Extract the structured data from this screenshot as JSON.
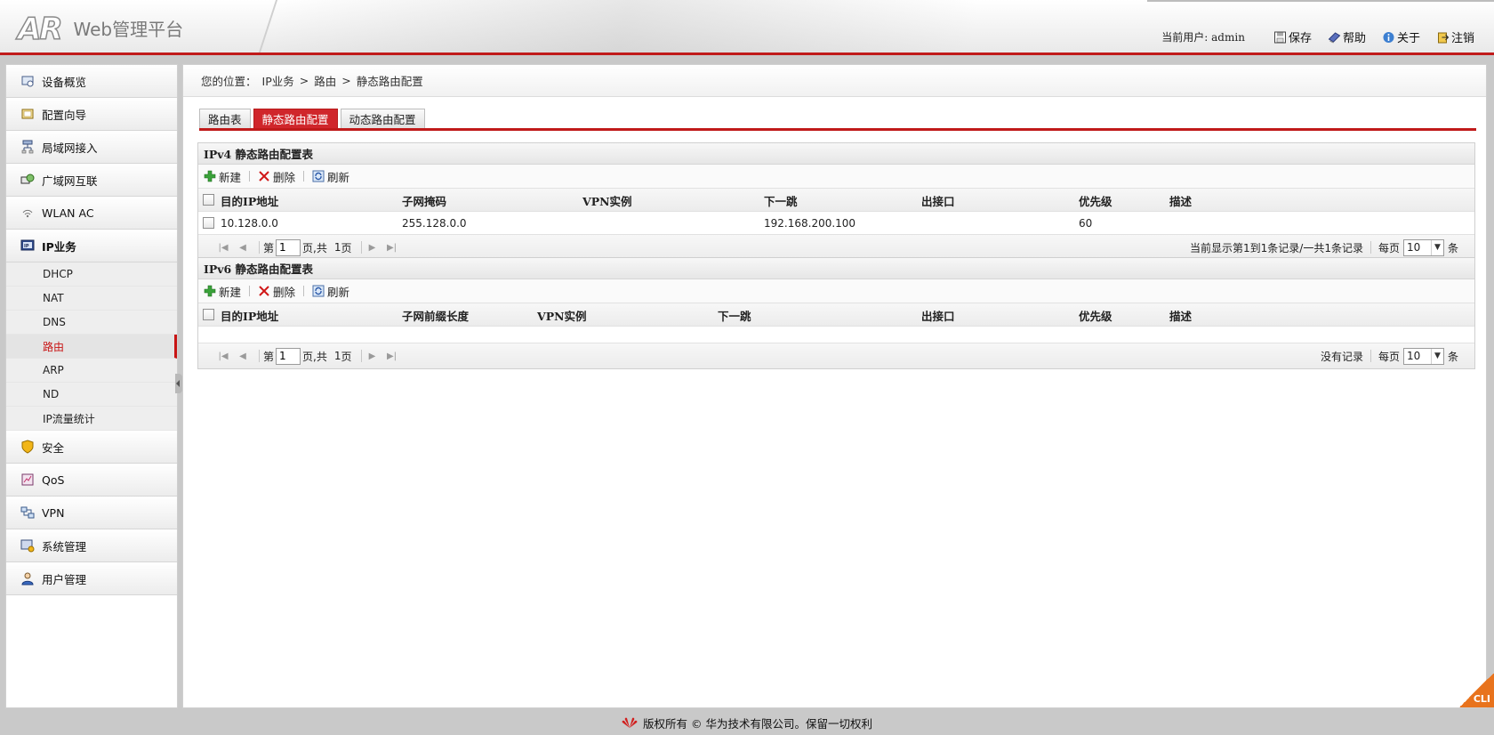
{
  "header": {
    "logo_mark": "AR",
    "title": "Web管理平台",
    "user_label": "当前用户: admin",
    "links": {
      "save": "保存",
      "help": "帮助",
      "about": "关于",
      "logout": "注销"
    }
  },
  "sidebar": {
    "items": [
      {
        "label": "设备概览",
        "icon": "overview-icon"
      },
      {
        "label": "配置向导",
        "icon": "wizard-icon"
      },
      {
        "label": "局域网接入",
        "icon": "lan-icon"
      },
      {
        "label": "广域网互联",
        "icon": "wan-icon"
      },
      {
        "label": "WLAN AC",
        "icon": "wlan-icon"
      },
      {
        "label": "IP业务",
        "icon": "ip-service-icon"
      }
    ],
    "sub_items": [
      "DHCP",
      "NAT",
      "DNS",
      "路由",
      "ARP",
      "ND",
      "IP流量统计"
    ],
    "items_after": [
      {
        "label": "安全",
        "icon": "security-shield-icon"
      },
      {
        "label": "QoS",
        "icon": "qos-icon"
      },
      {
        "label": "VPN",
        "icon": "vpn-icon"
      },
      {
        "label": "系统管理",
        "icon": "system-icon"
      },
      {
        "label": "用户管理",
        "icon": "user-icon"
      }
    ]
  },
  "breadcrumb": {
    "prefix": "您的位置：",
    "level1": "IP业务",
    "sep": ">",
    "level2": "路由",
    "level3": "静态路由配置"
  },
  "tabs": [
    "路由表",
    "静态路由配置",
    "动态路由配置"
  ],
  "ipv4": {
    "title": "IPv4 静态路由配置表",
    "toolbar": {
      "new": "新建",
      "delete": "删除",
      "refresh": "刷新"
    },
    "columns": [
      "目的IP地址",
      "子网掩码",
      "VPN实例",
      "下一跳",
      "出接口",
      "优先级",
      "描述"
    ],
    "rows": [
      [
        "10.128.0.0",
        "255.128.0.0",
        "",
        "192.168.200.100",
        "",
        "60",
        ""
      ]
    ],
    "pager": {
      "page_prefix": "第",
      "page_value": "1",
      "page_suffix": "页,共",
      "total_pages": "1",
      "page_unit": "页",
      "summary": "当前显示第1到1条记录/一共1条记录",
      "per_page_label": "每页",
      "per_page_value": "10",
      "per_page_unit": "条"
    }
  },
  "ipv6": {
    "title": "IPv6 静态路由配置表",
    "toolbar": {
      "new": "新建",
      "delete": "删除",
      "refresh": "刷新"
    },
    "columns": [
      "目的IP地址",
      "子网前缀长度",
      "VPN实例",
      "下一跳",
      "出接口",
      "优先级",
      "描述"
    ],
    "rows": [],
    "pager": {
      "page_prefix": "第",
      "page_value": "1",
      "page_suffix": "页,共",
      "total_pages": "1",
      "page_unit": "页",
      "summary": "没有记录",
      "per_page_label": "每页",
      "per_page_value": "10",
      "per_page_unit": "条"
    }
  },
  "cli_label": "CLI",
  "footer": {
    "text": "版权所有 © 华为技术有限公司。保留一切权利",
    "logo_icon": "huawei-logo-icon"
  },
  "colors": {
    "accent_red": "#c01a1a",
    "active_tab": "#d0262b",
    "cli_orange": "#e8731d"
  }
}
